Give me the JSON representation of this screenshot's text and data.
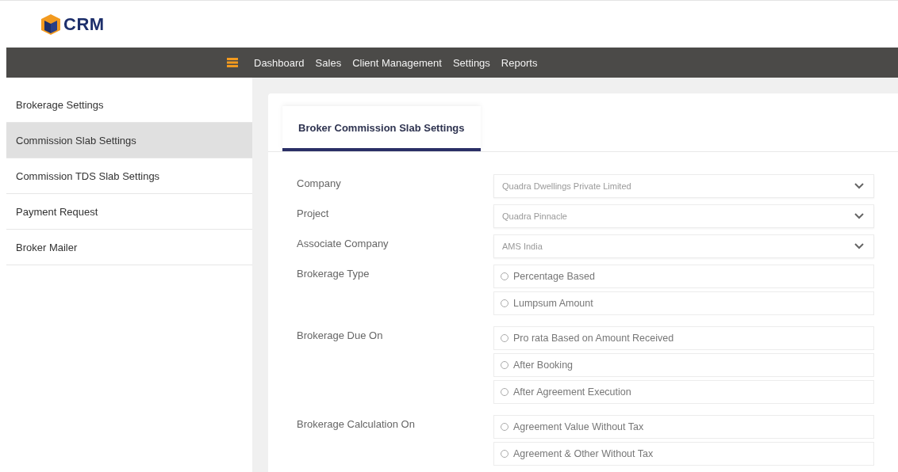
{
  "logo": {
    "text": "CRM"
  },
  "nav": {
    "items": [
      {
        "label": "Dashboard"
      },
      {
        "label": "Sales"
      },
      {
        "label": "Client Management"
      },
      {
        "label": "Settings"
      },
      {
        "label": "Reports"
      }
    ]
  },
  "sidebar": {
    "items": [
      {
        "label": "Brokerage Settings",
        "selected": false
      },
      {
        "label": "Commission Slab Settings",
        "selected": true
      },
      {
        "label": "Commission TDS Slab Settings",
        "selected": false
      },
      {
        "label": "Payment Request",
        "selected": false
      },
      {
        "label": "Broker Mailer",
        "selected": false
      }
    ]
  },
  "tabs": [
    {
      "label": "Broker Commission Slab Settings",
      "selected": true
    }
  ],
  "form": {
    "rows": [
      {
        "label": "Company",
        "kind": "select",
        "value": "Quadra Dwellings Private Limited"
      },
      {
        "label": "Project",
        "kind": "select",
        "value": "Quadra Pinnacle"
      },
      {
        "label": "Associate Company",
        "kind": "select",
        "value": "AMS India"
      },
      {
        "label": "Brokerage Type",
        "kind": "radio",
        "options": [
          {
            "label": "Percentage Based",
            "selected": false
          },
          {
            "label": "Lumpsum Amount",
            "selected": false
          }
        ]
      },
      {
        "label": "Brokerage Due On",
        "kind": "radio",
        "options": [
          {
            "label": "Pro rata Based on Amount Received",
            "selected": false
          },
          {
            "label": "After Booking",
            "selected": false
          },
          {
            "label": "After Agreement Execution",
            "selected": false
          }
        ]
      },
      {
        "label": "Brokerage Calculation On",
        "kind": "radio",
        "options": [
          {
            "label": "Agreement Value Without Tax",
            "selected": false
          },
          {
            "label": "Agreement & Other Without Tax",
            "selected": false
          }
        ]
      }
    ]
  }
}
